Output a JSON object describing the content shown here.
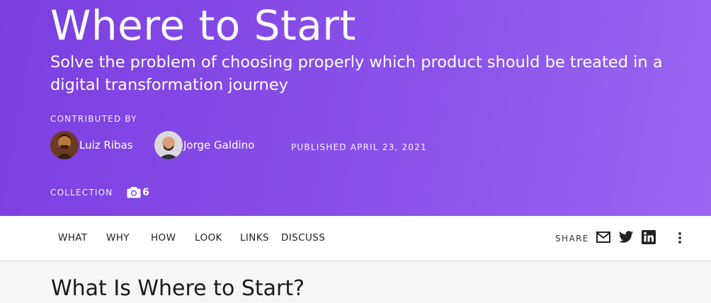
{
  "hero": {
    "title": "Where to Start",
    "subtitle": "Solve the problem of choosing properly which product should be treated in a digital transformation journey",
    "contributed_label": "CONTRIBUTED BY",
    "authors": [
      {
        "name": "Luiz Ribas",
        "avatar_icon": "avatar-photo"
      },
      {
        "name": "Jorge Galdino",
        "avatar_icon": "avatar-photo"
      }
    ],
    "published": "PUBLISHED APRIL 23, 2021",
    "collection_label": "COLLECTION",
    "collection_count": "6",
    "collection_icon": "camera-icon"
  },
  "nav": {
    "tabs": [
      "WHAT",
      "WHY",
      "HOW",
      "LOOK",
      "LINKS",
      "DISCUSS"
    ],
    "share_label": "SHARE",
    "share_icons": [
      "mail-icon",
      "twitter-icon",
      "linkedin-icon"
    ],
    "more_icon": "more-vertical-icon"
  },
  "content": {
    "heading": "What Is Where to Start?"
  },
  "colors": {
    "hero_start": "#7b3fe0",
    "hero_end": "#9a66f0",
    "nav_bg": "#ffffff",
    "page_bg": "#f6f6f6"
  }
}
